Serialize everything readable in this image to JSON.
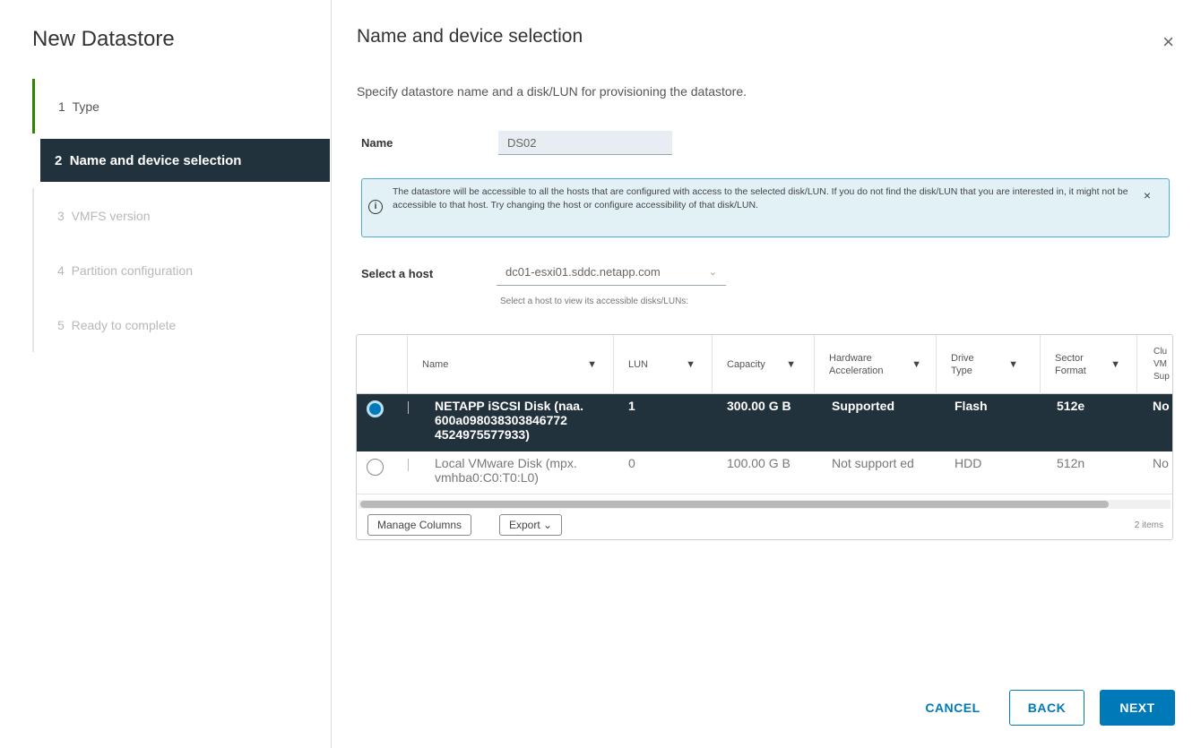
{
  "wizard": {
    "title": "New Datastore",
    "steps": [
      {
        "num": "1",
        "label": "Type"
      },
      {
        "num": "2",
        "label": "Name and device selection"
      },
      {
        "num": "3",
        "label": "VMFS version"
      },
      {
        "num": "4",
        "label": "Partition configuration"
      },
      {
        "num": "5",
        "label": "Ready to complete"
      }
    ]
  },
  "main": {
    "title": "Name and device selection",
    "close_glyph": "×",
    "subtitle": "Specify datastore name and a disk/LUN for provisioning the datastore.",
    "name_label": "Name",
    "name_value": "DS02",
    "alert": {
      "icon_glyph": "i",
      "text": "The datastore will be accessible to all the hosts that are configured with access to the selected disk/LUN. If you do not find the disk/LUN that you are interested in, it might not be accessible to that host. Try changing the host or configure accessibility of that disk/LUN.",
      "close_glyph": "×"
    },
    "host_label": "Select a host",
    "host_value": "dc01-esxi01.sddc.netapp.com",
    "host_hint": "Select a host to view its accessible disks/LUNs:"
  },
  "grid": {
    "columns": [
      "Name",
      "LUN",
      "Capacity",
      "Hardware Acceleration",
      "Drive Type",
      "Sector Format",
      "Clu VM Sup"
    ],
    "rows": [
      {
        "name": "NETAPP iSCSI Disk (naa. 600a098038303846772 4524975577933)",
        "lun": "1",
        "capacity": "300.00 G B",
        "hw": "Supported",
        "drive": "Flash",
        "sector": "512e",
        "cluster": "No",
        "selected": true
      },
      {
        "name": "Local VMware Disk (mpx. vmhba0:C0:T0:L0)",
        "lun": "0",
        "capacity": "100.00 G B",
        "hw": "Not support ed",
        "drive": "HDD",
        "sector": "512n",
        "cluster": "No",
        "selected": false
      }
    ],
    "manage_columns": "Manage Columns",
    "export": "Export ⌄",
    "items_count": "2 items"
  },
  "footer": {
    "cancel": "CANCEL",
    "back": "BACK",
    "next": "NEXT"
  },
  "colors": {
    "accent": "#0079b8",
    "selected_row": "#22323d",
    "alert_bg": "#e1f1f6",
    "step_done": "#2f8400"
  }
}
